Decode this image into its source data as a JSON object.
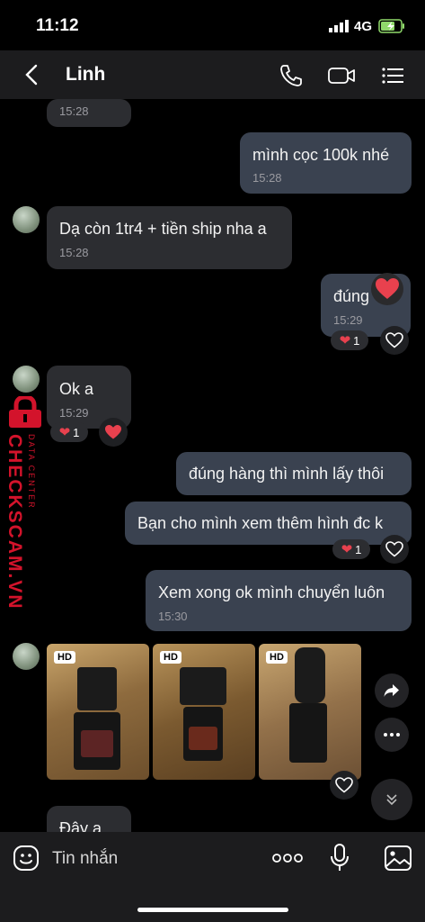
{
  "status": {
    "time": "11:12",
    "network": "4G"
  },
  "header": {
    "contact_name": "Linh"
  },
  "messages": [
    {
      "text": "",
      "time": "15:28"
    },
    {
      "text": "mình cọc 100k nhé",
      "time": "15:28"
    },
    {
      "text": "Dạ còn 1tr4 + tiền ship nha a",
      "time": "15:28"
    },
    {
      "text": "đúng",
      "time": "15:29",
      "reaction_count": "1"
    },
    {
      "text": "Ok a",
      "time": "15:29",
      "reaction_count": "1"
    },
    {
      "text": "đúng hàng thì mình lấy thôi"
    },
    {
      "text": "Bạn cho mình xem thêm hình đc k",
      "reaction_count": "1"
    },
    {
      "text": "Xem xong ok mình chuyển luôn",
      "time": "15:30"
    },
    {
      "text": "Đây a"
    }
  ],
  "photos": [
    {
      "badge": "HD",
      "icon": "flash-camera-photo"
    },
    {
      "badge": "HD",
      "icon": "flash-camera-photo"
    },
    {
      "badge": "HD",
      "icon": "flash-camera-photo"
    }
  ],
  "watermark": {
    "main": "CHECKSCAM.VN",
    "sub": "DATA CENTER"
  },
  "composer": {
    "placeholder": "Tin nhắn"
  },
  "colors": {
    "background": "#000000",
    "bubble": "#2c2d31",
    "heart": "#e8414e",
    "watermark": "#d3132b"
  }
}
